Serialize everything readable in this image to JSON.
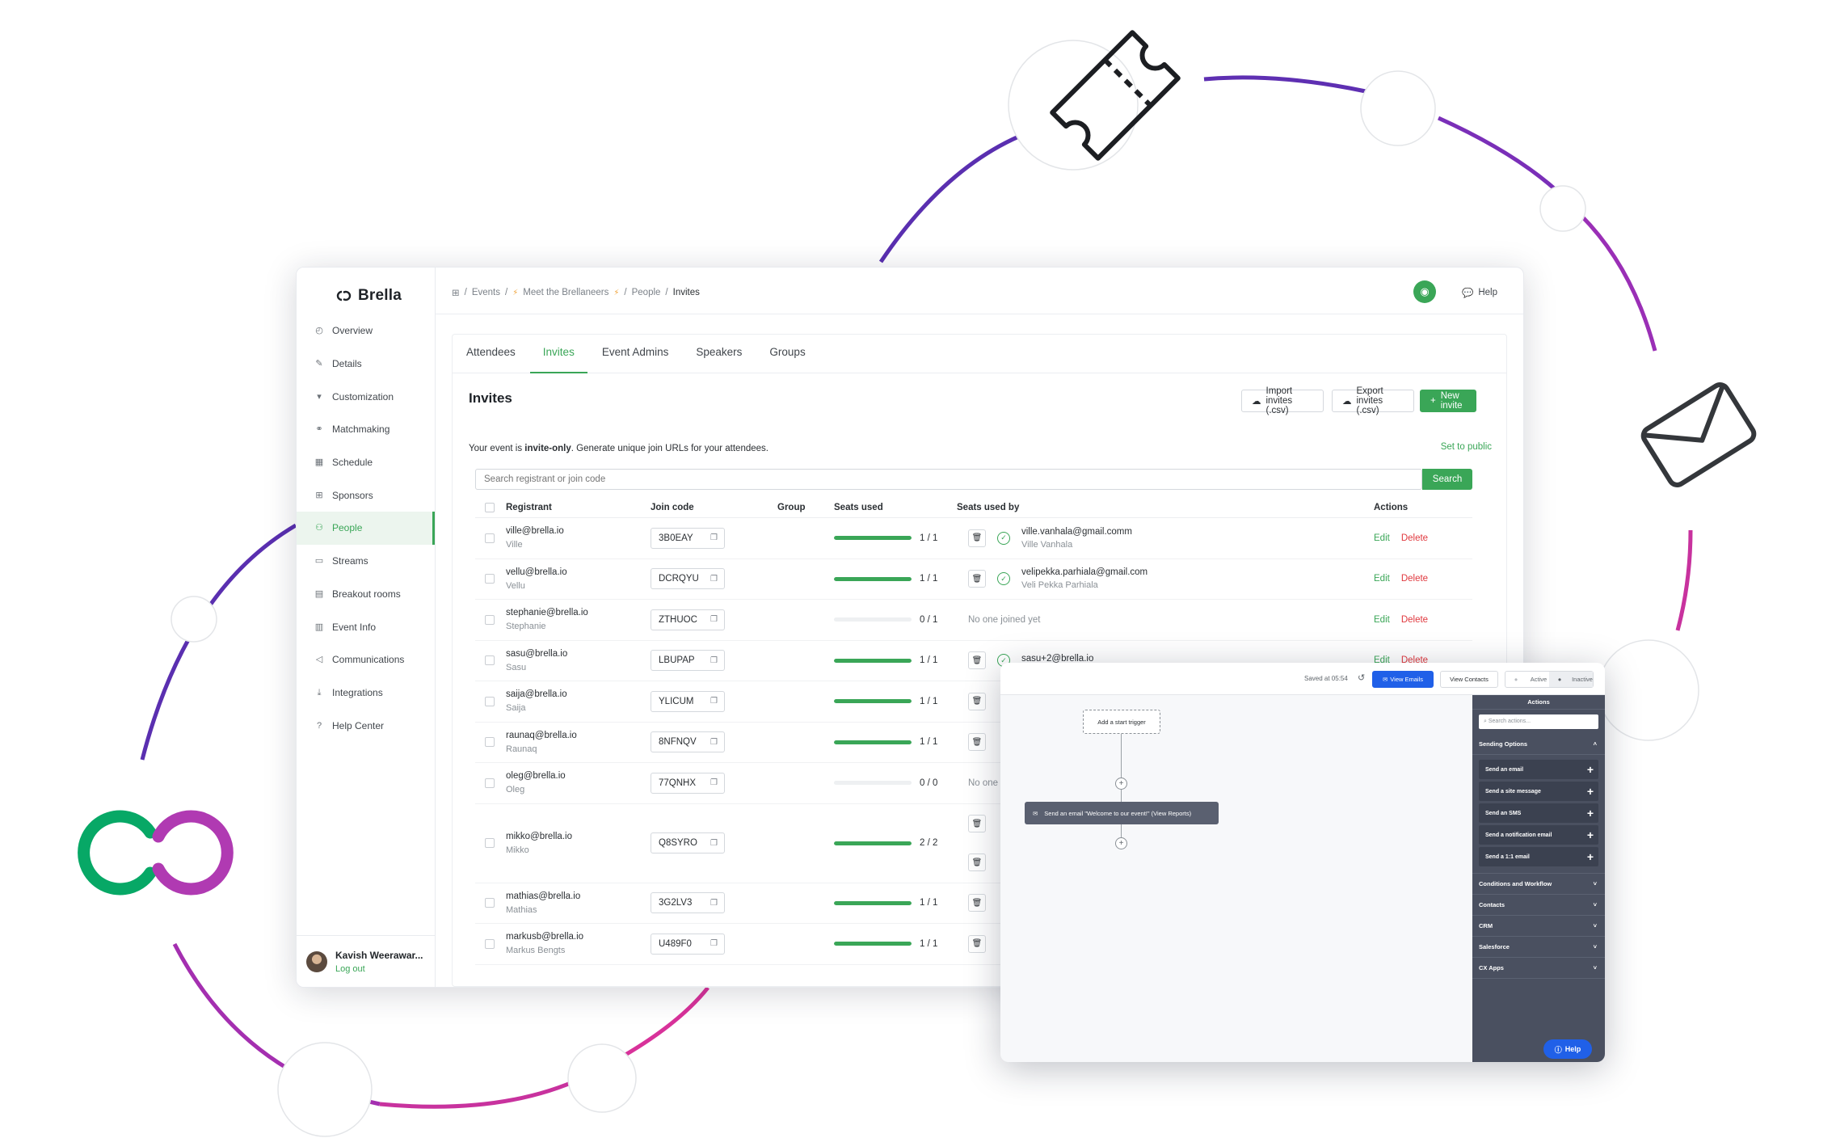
{
  "brand": {
    "name": "Brella",
    "green": "#07a866",
    "magenta": "#b03ab2",
    "accent": "#3aa657"
  },
  "decor_icons": [
    "ticket-icon",
    "envelope-icon",
    "brella-logo-large"
  ],
  "sidebar": {
    "items": [
      {
        "label": "Overview",
        "icon": "overview-icon"
      },
      {
        "label": "Details",
        "icon": "details-icon"
      },
      {
        "label": "Customization",
        "icon": "customization-icon"
      },
      {
        "label": "Matchmaking",
        "icon": "matchmaking-icon"
      },
      {
        "label": "Schedule",
        "icon": "schedule-icon"
      },
      {
        "label": "Sponsors",
        "icon": "sponsors-icon"
      },
      {
        "label": "People",
        "icon": "people-icon"
      },
      {
        "label": "Streams",
        "icon": "streams-icon"
      },
      {
        "label": "Breakout rooms",
        "icon": "breakout-icon"
      },
      {
        "label": "Event Info",
        "icon": "event-info-icon"
      },
      {
        "label": "Communications",
        "icon": "communications-icon"
      },
      {
        "label": "Integrations",
        "icon": "integrations-icon"
      },
      {
        "label": "Help Center",
        "icon": "help-center-icon"
      }
    ],
    "active_index": 6,
    "user": {
      "name": "Kavish Weerawar...",
      "logout": "Log out"
    }
  },
  "breadcrumb": {
    "events": "Events",
    "event": "Meet the Brellaneers",
    "people": "People",
    "current": "Invites"
  },
  "topbar": {
    "help": "Help"
  },
  "tabs": [
    "Attendees",
    "Invites",
    "Event Admins",
    "Speakers",
    "Groups"
  ],
  "active_tab": 1,
  "page": {
    "title": "Invites",
    "import_label": "Import invites (.csv)",
    "export_label": "Export invites (.csv)",
    "new_label": "New invite",
    "notice_prefix": "Your event is ",
    "notice_bold": "invite-only",
    "notice_suffix": ". Generate unique join URLs for your attendees.",
    "set_public": "Set to public",
    "search_placeholder": "Search registrant or join code",
    "search_button": "Search"
  },
  "table": {
    "headers": {
      "registrant": "Registrant",
      "code": "Join code",
      "group": "Group",
      "seats": "Seats used",
      "by": "Seats used by",
      "actions": "Actions"
    },
    "edit": "Edit",
    "delete": "Delete",
    "rows": [
      {
        "email": "ville@brella.io",
        "name": "Ville",
        "code": "3B0EAY",
        "seats": "1 / 1",
        "fill": 1,
        "by": [
          {
            "email": "ville.vanhala@gmail.comm",
            "name": "Ville Vanhala"
          }
        ]
      },
      {
        "email": "vellu@brella.io",
        "name": "Vellu",
        "code": "DCRQYU",
        "seats": "1 / 1",
        "fill": 1,
        "by": [
          {
            "email": "velipekka.parhiala@gmail.com",
            "name": "Veli Pekka Parhiala"
          }
        ]
      },
      {
        "email": "stephanie@brella.io",
        "name": "Stephanie",
        "code": "ZTHUOC",
        "seats": "0 / 1",
        "fill": 0,
        "by": [],
        "none": "No one joined yet"
      },
      {
        "email": "sasu@brella.io",
        "name": "Sasu",
        "code": "LBUPAP",
        "seats": "1 / 1",
        "fill": 1,
        "by": [
          {
            "email": "sasu+2@brella.io",
            "name": ""
          }
        ]
      },
      {
        "email": "saija@brella.io",
        "name": "Saija",
        "code": "YLICUM",
        "seats": "1 / 1",
        "fill": 1,
        "by": [
          {
            "email": "",
            "name": ""
          }
        ]
      },
      {
        "email": "raunaq@brella.io",
        "name": "Raunaq",
        "code": "8NFNQV",
        "seats": "1 / 1",
        "fill": 1,
        "by": [
          {
            "email": "",
            "name": ""
          }
        ]
      },
      {
        "email": "oleg@brella.io",
        "name": "Oleg",
        "code": "77QNHX",
        "seats": "0 / 0",
        "fill": 0,
        "by": [],
        "none": "No one"
      },
      {
        "email": "mikko@brella.io",
        "name": "Mikko",
        "code": "Q8SYRO",
        "seats": "2 / 2",
        "fill": 1,
        "by": [
          {
            "email": "",
            "name": ""
          },
          {
            "email": "",
            "name": ""
          }
        ]
      },
      {
        "email": "mathias@brella.io",
        "name": "Mathias",
        "code": "3G2LV3",
        "seats": "1 / 1",
        "fill": 1,
        "by": [
          {
            "email": "",
            "name": ""
          }
        ]
      },
      {
        "email": "markusb@brella.io",
        "name": "Markus Bengts",
        "code": "U489F0",
        "seats": "1 / 1",
        "fill": 1,
        "by": [
          {
            "email": "",
            "name": ""
          }
        ]
      }
    ]
  },
  "workflow": {
    "saved": "Saved at 05:54",
    "view_emails": "View Emails",
    "view_contacts": "View Contacts",
    "active": "Active",
    "inactive": "Inactive",
    "start_trigger": "Add a start trigger",
    "step": "Send an email \"Welcome to our event!\" (View Reports)",
    "panel_title": "Actions",
    "panel_search": "Search actions...",
    "sending_options": "Sending Options",
    "actions": [
      "Send an email",
      "Send a site message",
      "Send an SMS",
      "Send a notification email",
      "Send a 1:1 email"
    ],
    "sections": [
      "Conditions and Workflow",
      "Contacts",
      "CRM",
      "Salesforce",
      "CX Apps"
    ],
    "help": "Help"
  }
}
